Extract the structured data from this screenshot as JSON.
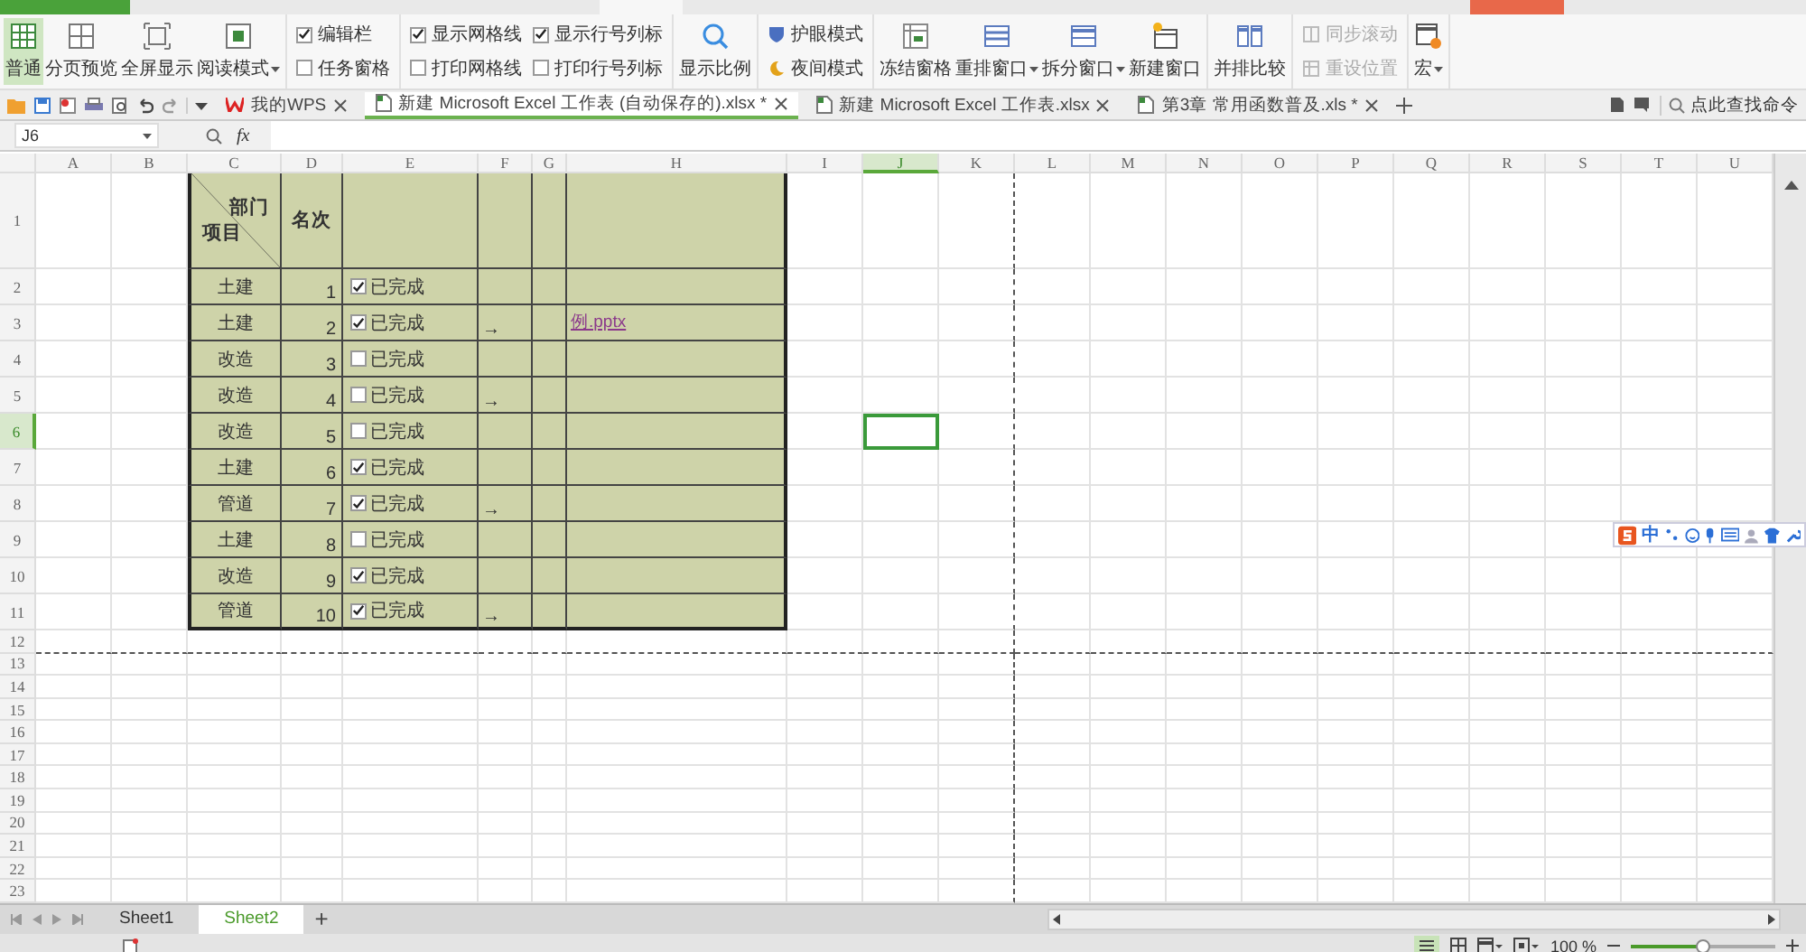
{
  "ribbon": [
    {
      "kind": "buttons",
      "items": [
        {
          "label": "普通",
          "selected": true,
          "dropdown": false
        },
        {
          "label": "分页预览",
          "selected": false,
          "dropdown": false
        },
        {
          "label": "全屏显示",
          "selected": false,
          "dropdown": false
        },
        {
          "label": "阅读模式",
          "selected": false,
          "dropdown": true
        }
      ]
    },
    {
      "kind": "checks",
      "items": [
        {
          "label": "编辑栏",
          "checked": true
        },
        {
          "label": "任务窗格",
          "checked": false
        }
      ]
    },
    {
      "kind": "checks",
      "items": [
        {
          "label": "显示网格线",
          "checked": true
        },
        {
          "label": "显示行号列标",
          "checked": true
        },
        {
          "label": "打印网格线",
          "checked": false
        },
        {
          "label": "打印行号列标",
          "checked": false
        }
      ]
    },
    {
      "kind": "buttons",
      "items": [
        {
          "label": "显示比例",
          "selected": false,
          "dropdown": false
        }
      ]
    },
    {
      "kind": "small",
      "items": [
        {
          "label": "护眼模式",
          "disabled": false
        },
        {
          "label": "夜间模式",
          "disabled": false
        }
      ]
    },
    {
      "kind": "buttons",
      "items": [
        {
          "label": "冻结窗格",
          "selected": false,
          "dropdown": false
        },
        {
          "label": "重排窗口",
          "selected": false,
          "dropdown": true
        },
        {
          "label": "拆分窗口",
          "selected": false,
          "dropdown": true
        },
        {
          "label": "新建窗口",
          "selected": false,
          "dropdown": false
        }
      ]
    },
    {
      "kind": "buttons",
      "items": [
        {
          "label": "并排比较",
          "selected": false,
          "dropdown": false
        }
      ]
    },
    {
      "kind": "small",
      "items": [
        {
          "label": "同步滚动",
          "disabled": true
        },
        {
          "label": "重设位置",
          "disabled": true
        }
      ]
    },
    {
      "kind": "buttons",
      "items": [
        {
          "label": "宏",
          "selected": false,
          "dropdown": true
        }
      ]
    }
  ],
  "doc_tabs": [
    {
      "label": "我的WPS",
      "selected": false
    },
    {
      "label": "新建 Microsoft Excel 工作表 (自动保存的).xlsx *",
      "selected": true
    },
    {
      "label": "新建 Microsoft Excel 工作表.xlsx",
      "selected": false
    },
    {
      "label": "第3章 常用函数普及.xls *",
      "selected": false
    }
  ],
  "command_search": {
    "placeholder": "点此查找命令"
  },
  "formula_bar": {
    "name_box": "J6",
    "fx": "fx"
  },
  "sheet": {
    "columns": [
      {
        "label": "A",
        "selected": false
      },
      {
        "label": "B",
        "selected": false
      },
      {
        "label": "C",
        "selected": false
      },
      {
        "label": "D",
        "selected": false
      },
      {
        "label": "E",
        "selected": false
      },
      {
        "label": "F",
        "selected": false
      },
      {
        "label": "G",
        "selected": false
      },
      {
        "label": "H",
        "selected": false
      },
      {
        "label": "I",
        "selected": false
      },
      {
        "label": "J",
        "selected": true
      },
      {
        "label": "K",
        "selected": false
      },
      {
        "label": "L",
        "selected": false
      },
      {
        "label": "M",
        "selected": false
      },
      {
        "label": "N",
        "selected": false
      },
      {
        "label": "O",
        "selected": false
      },
      {
        "label": "P",
        "selected": false
      },
      {
        "label": "Q",
        "selected": false
      },
      {
        "label": "R",
        "selected": false
      },
      {
        "label": "S",
        "selected": false
      },
      {
        "label": "T",
        "selected": false
      },
      {
        "label": "U",
        "selected": false
      }
    ],
    "rows": [
      {
        "label": "1",
        "selected": false
      },
      {
        "label": "2",
        "selected": false
      },
      {
        "label": "3",
        "selected": false
      },
      {
        "label": "4",
        "selected": false
      },
      {
        "label": "5",
        "selected": false
      },
      {
        "label": "6",
        "selected": true
      },
      {
        "label": "7",
        "selected": false
      },
      {
        "label": "8",
        "selected": false
      },
      {
        "label": "9",
        "selected": false
      },
      {
        "label": "10",
        "selected": false
      },
      {
        "label": "11",
        "selected": false
      },
      {
        "label": "12",
        "selected": false
      },
      {
        "label": "13",
        "selected": false
      },
      {
        "label": "14",
        "selected": false
      },
      {
        "label": "15",
        "selected": false
      },
      {
        "label": "16",
        "selected": false
      },
      {
        "label": "17",
        "selected": false
      },
      {
        "label": "18",
        "selected": false
      },
      {
        "label": "19",
        "selected": false
      },
      {
        "label": "20",
        "selected": false
      },
      {
        "label": "21",
        "selected": false
      },
      {
        "label": "22",
        "selected": false
      },
      {
        "label": "23",
        "selected": false
      }
    ],
    "table": {
      "header": {
        "column_label": "部门",
        "row_label": "项目",
        "rank": "名次"
      },
      "rows": [
        {
          "category": "土建",
          "rank": "1",
          "done": {
            "checked": true,
            "label": "已完成"
          }
        },
        {
          "category": "土建",
          "rank": "2",
          "done": {
            "checked": true,
            "label": "已完成"
          },
          "arrow": "→",
          "link": "例.pptx"
        },
        {
          "category": "改造",
          "rank": "3",
          "done": {
            "checked": false,
            "label": "已完成"
          }
        },
        {
          "category": "改造",
          "rank": "4",
          "done": {
            "checked": false,
            "label": "已完成"
          },
          "arrow": "→"
        },
        {
          "category": "改造",
          "rank": "5",
          "done": {
            "checked": false,
            "label": "已完成"
          }
        },
        {
          "category": "土建",
          "rank": "6",
          "done": {
            "checked": true,
            "label": "已完成"
          }
        },
        {
          "category": "管道",
          "rank": "7",
          "done": {
            "checked": true,
            "label": "已完成"
          },
          "arrow": "→"
        },
        {
          "category": "土建",
          "rank": "8",
          "done": {
            "checked": false,
            "label": "已完成"
          }
        },
        {
          "category": "改造",
          "rank": "9",
          "done": {
            "checked": true,
            "label": "已完成"
          }
        },
        {
          "category": "管道",
          "rank": "10",
          "done": {
            "checked": true,
            "label": "已完成"
          },
          "arrow": "→"
        }
      ]
    }
  },
  "ime_toolbar": {
    "mode": "中"
  },
  "sheet_tabs": [
    {
      "label": "Sheet1",
      "selected": false
    },
    {
      "label": "Sheet2",
      "selected": true
    }
  ],
  "add_sheet": "+",
  "status_bar": {
    "zoom": "100 %",
    "level": 0.5
  }
}
